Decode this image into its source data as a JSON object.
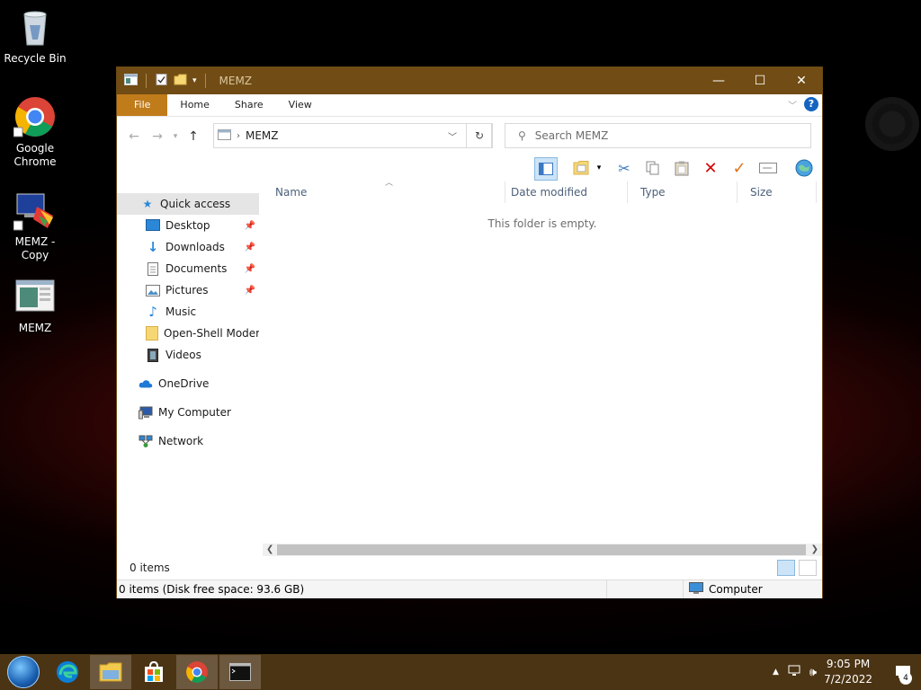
{
  "desktop": {
    "icons": [
      {
        "label": "Recycle Bin",
        "icon": "recycle-bin-icon"
      },
      {
        "label": "Google Chrome",
        "icon": "chrome-icon"
      },
      {
        "label": "MEMZ - Copy",
        "icon": "memz-copy-icon"
      },
      {
        "label": "MEMZ",
        "icon": "memz-icon"
      }
    ]
  },
  "window": {
    "title": "MEMZ",
    "controls": {
      "minimize": "—",
      "maximize": "☐",
      "close": "✕"
    },
    "ribbon_tabs": [
      "File",
      "Home",
      "Share",
      "View"
    ],
    "help": "?",
    "address": {
      "path": "MEMZ"
    },
    "search": {
      "placeholder": "Search MEMZ"
    },
    "nav_pane": {
      "quick_access": "Quick access",
      "items": [
        "Desktop",
        "Downloads",
        "Documents",
        "Pictures",
        "Music",
        "Open-Shell Modern",
        "Videos"
      ],
      "onedrive": "OneDrive",
      "my_computer": "My Computer",
      "network": "Network"
    },
    "columns": [
      "Name",
      "Date modified",
      "Type",
      "Size"
    ],
    "empty_message": "This folder is empty.",
    "status": {
      "item_count": "0 items",
      "disk_info": "0 items (Disk free space: 93.6 GB)",
      "location": "Computer"
    }
  },
  "taskbar": {
    "time": "9:05 PM",
    "date": "7/2/2022",
    "notification_count": "4"
  },
  "colors": {
    "titlebar": "#714c14",
    "file_tab": "#c07b1b",
    "taskbar": "#4b3414"
  }
}
